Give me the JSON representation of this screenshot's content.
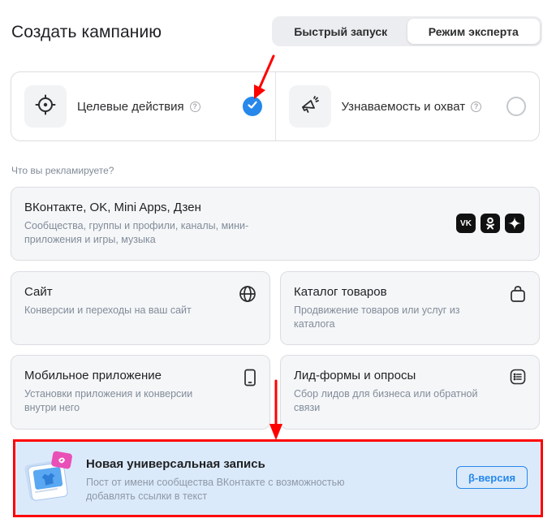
{
  "header": {
    "title": "Создать кампанию",
    "modes": [
      {
        "label": "Быстрый запуск",
        "active": false
      },
      {
        "label": "Режим эксперта",
        "active": true
      }
    ]
  },
  "goals": [
    {
      "label": "Целевые действия",
      "help": "?",
      "selected": true,
      "icon": "target-icon"
    },
    {
      "label": "Узнаваемость и охват",
      "help": "?",
      "selected": false,
      "icon": "megaphone-icon"
    }
  ],
  "section_label": "Что вы рекламируете?",
  "cards": {
    "vk": {
      "title": "ВКонтакте, OK, Mini Apps, Дзен",
      "desc": "Сообщества, группы и профили, каналы, мини-приложения и игры, музыка",
      "brand_vk": "VK"
    },
    "site": {
      "title": "Сайт",
      "desc": "Конверсии и переходы на ваш сайт"
    },
    "catalog": {
      "title": "Каталог товаров",
      "desc": "Продвижение товаров или услуг из каталога"
    },
    "mobile": {
      "title": "Мобильное приложение",
      "desc": "Установки приложения и конверсии внутри него"
    },
    "leads": {
      "title": "Лид-формы и опросы",
      "desc": "Сбор лидов для бизнеса или обратной связи"
    },
    "universal": {
      "title": "Новая универсальная запись",
      "desc": "Пост от имени сообщества ВКонтакте с возможностью добавлять ссылки в текст",
      "badge": "β-версия"
    }
  },
  "colors": {
    "accent": "#2688eb",
    "highlight_frame": "#ff0000",
    "universal_bg": "#dbeafb"
  }
}
